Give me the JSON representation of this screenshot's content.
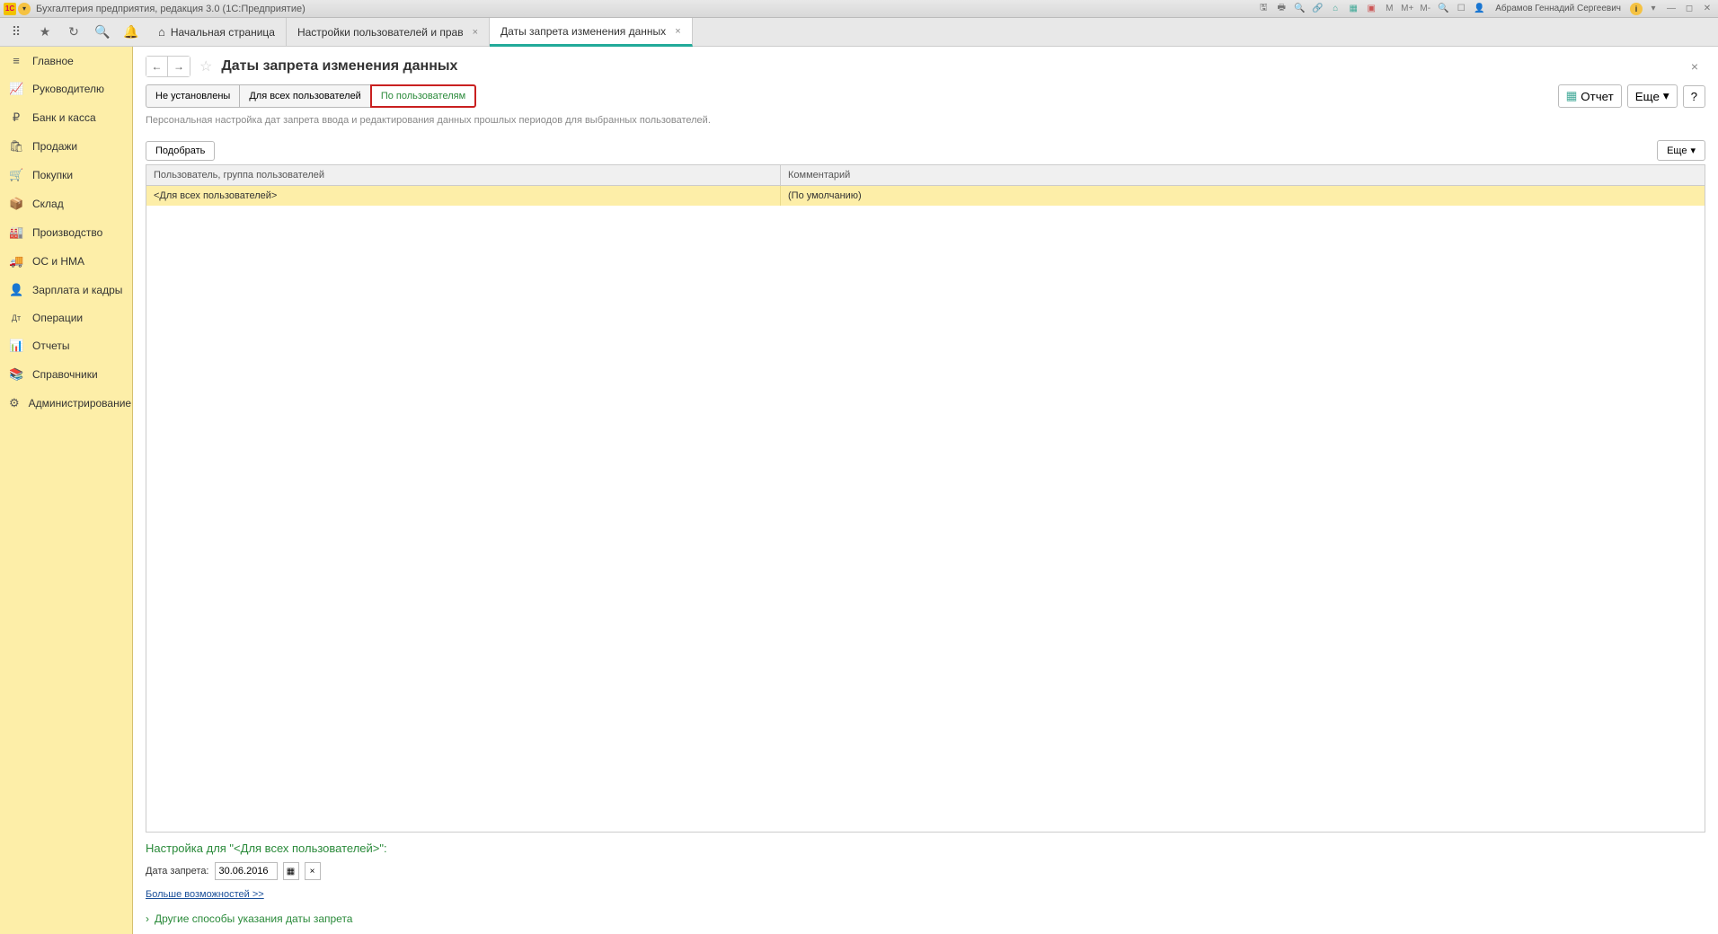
{
  "titlebar": {
    "app_title": "Бухгалтерия предприятия, редакция 3.0  (1С:Предприятие)",
    "user": "Абрамов Геннадий Сергеевич",
    "m_labels": [
      "M",
      "M+",
      "M-"
    ]
  },
  "tabs": [
    {
      "label": "Начальная страница",
      "closable": false,
      "home": true
    },
    {
      "label": "Настройки пользователей и прав",
      "closable": true
    },
    {
      "label": "Даты запрета изменения данных",
      "closable": true,
      "active": true
    }
  ],
  "sidebar": [
    {
      "icon": "≡",
      "label": "Главное"
    },
    {
      "icon": "📈",
      "label": "Руководителю"
    },
    {
      "icon": "₽",
      "label": "Банк и касса"
    },
    {
      "icon": "🛍",
      "label": "Продажи"
    },
    {
      "icon": "🛒",
      "label": "Покупки"
    },
    {
      "icon": "📦",
      "label": "Склад"
    },
    {
      "icon": "🏭",
      "label": "Производство"
    },
    {
      "icon": "🚚",
      "label": "ОС и НМА"
    },
    {
      "icon": "👤",
      "label": "Зарплата и кадры"
    },
    {
      "icon": "Дт",
      "label": "Операции"
    },
    {
      "icon": "📊",
      "label": "Отчеты"
    },
    {
      "icon": "📚",
      "label": "Справочники"
    },
    {
      "icon": "⚙",
      "label": "Администрирование"
    }
  ],
  "page": {
    "title": "Даты запрета изменения данных",
    "modes": [
      "Не установлены",
      "Для всех пользователей",
      "По пользователям"
    ],
    "active_mode": 2,
    "report_btn": "Отчет",
    "more_btn": "Еще",
    "help_btn": "?",
    "description": "Персональная настройка дат запрета ввода и редактирования данных прошлых периодов для выбранных пользователей.",
    "pick_btn": "Подобрать",
    "grid_more": "Еще",
    "columns": [
      "Пользователь, группа пользователей",
      "Комментарий"
    ],
    "rows": [
      {
        "user": "<Для всех пользователей>",
        "comment": "(По умолчанию)"
      }
    ],
    "settings_title": "Настройка для \"<Для всех пользователей>\":",
    "date_label": "Дата запрета:",
    "date_value": "30.06.2016",
    "more_link": "Больше возможностей >>",
    "expand_label": "Другие способы указания даты запрета"
  }
}
